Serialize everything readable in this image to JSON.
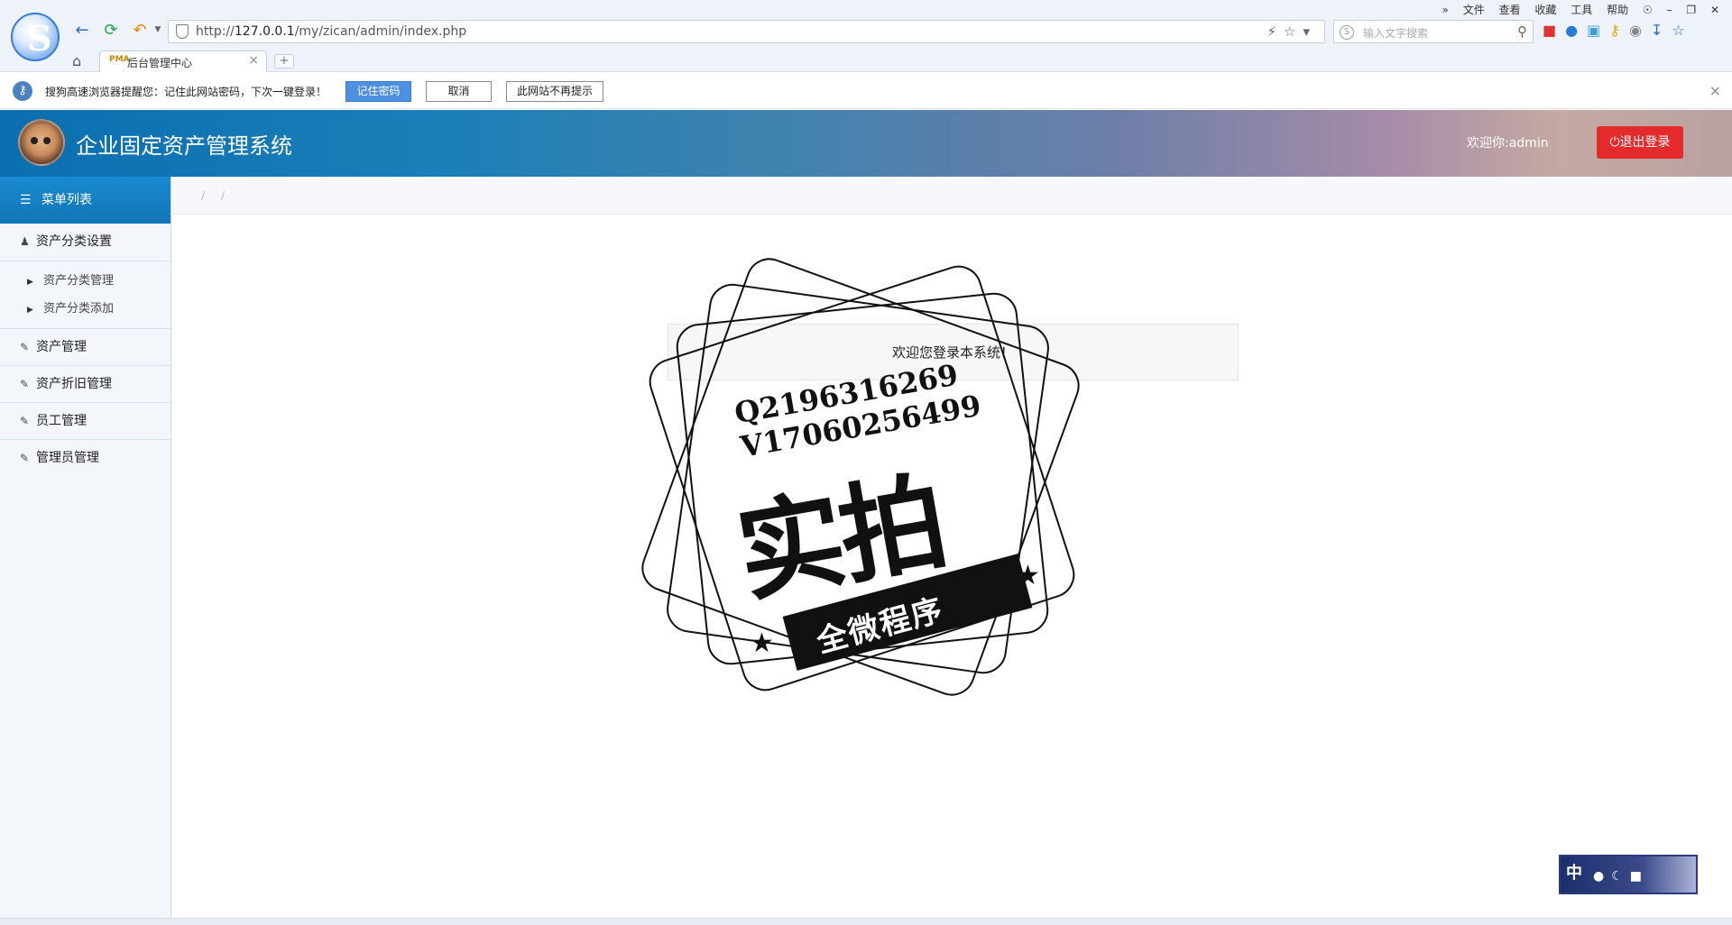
{
  "browser": {
    "url_prefix": "http://",
    "url_host": "127.0.0.1",
    "url_path": "/my/zican/admin/index.php",
    "search_placeholder": "输入文字搜索",
    "top_menu": [
      "文件",
      "查看",
      "收藏",
      "工具",
      "帮助"
    ],
    "tab_title": "后台管理中心",
    "tab_favicon": "PMA"
  },
  "password_bar": {
    "message": "搜狗高速浏览器提醒您：记住此网站密码，下次一键登录！",
    "remember": "记住密码",
    "cancel": "取消",
    "never": "此网站不再提示"
  },
  "header": {
    "title": "企业固定资产管理系统",
    "welcome": "欢迎你:admin",
    "logout": "退出登录"
  },
  "sidebar": {
    "head": "菜单列表",
    "sections": [
      {
        "label": "资产分类设置",
        "subs": [
          "资产分类管理",
          "资产分类添加"
        ]
      },
      {
        "label": "资产管理"
      },
      {
        "label": "资产折旧管理"
      },
      {
        "label": "员工管理"
      },
      {
        "label": "管理员管理"
      }
    ]
  },
  "breadcrumb": [
    "/",
    "/"
  ],
  "main": {
    "welcome": "欢迎您登录本系统！"
  },
  "watermark": {
    "contact_q": "Q2196316269",
    "contact_v": "V17060256499",
    "big": "实拍",
    "ribbon": "全微程序"
  },
  "ime": {
    "mode": "中"
  }
}
